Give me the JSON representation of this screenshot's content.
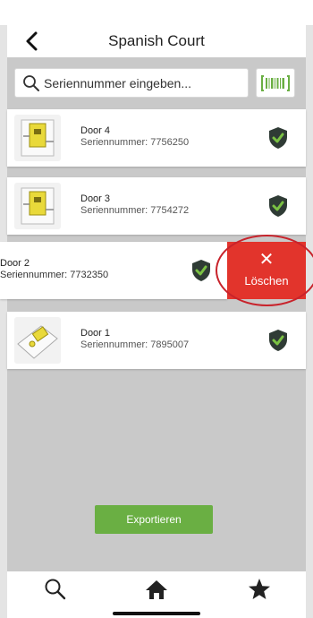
{
  "header": {
    "title": "Spanish Court"
  },
  "search": {
    "placeholder": "Seriennummer eingeben..."
  },
  "devices": [
    {
      "name": "Door 4",
      "serial": "Seriennummer: 7756250"
    },
    {
      "name": "Door 3",
      "serial": "Seriennummer: 7754272"
    },
    {
      "name": "Door 2",
      "serial": "Seriennummer: 7732350"
    },
    {
      "name": "Door 1",
      "serial": "Seriennummer: 7895007"
    }
  ],
  "swipe_action": {
    "label": "Löschen",
    "icon": "close-icon",
    "color": "#e2342c"
  },
  "export_button": {
    "label": "Exportieren",
    "color": "#6aaf43"
  },
  "tabbar": {
    "items": [
      "search-icon",
      "home-icon",
      "star-icon"
    ]
  },
  "colors": {
    "shield": "#47903e",
    "check": "#7ac143",
    "barcode": "#6aaf43",
    "highlight_circle": "#c8232b"
  }
}
